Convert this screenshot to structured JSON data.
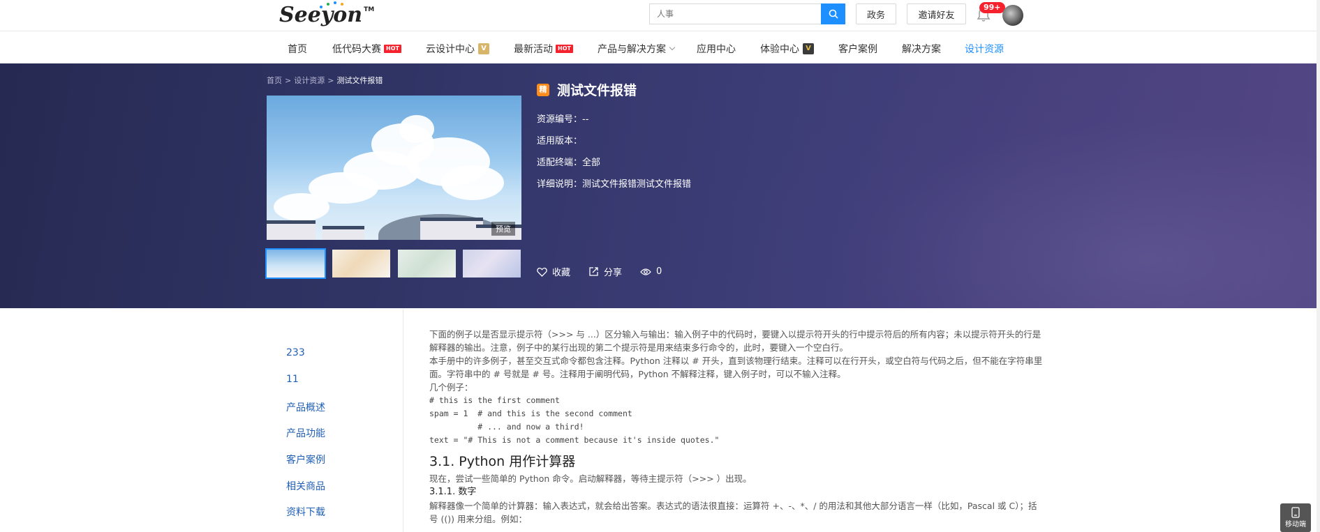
{
  "header": {
    "logo_text": "Seeyon",
    "logo_tm": "TM",
    "search_placeholder": "人事",
    "gov_button": "政务",
    "invite_button": "邀请好友",
    "notification_badge": "99+"
  },
  "nav": {
    "items": [
      {
        "label": "首页"
      },
      {
        "label": "低代码大赛",
        "tag": "HOT"
      },
      {
        "label": "云设计中心",
        "vtag": "V"
      },
      {
        "label": "最新活动",
        "tag": "HOT"
      },
      {
        "label": "产品与解决方案"
      },
      {
        "label": "应用中心"
      },
      {
        "label": "体验中心",
        "vtag": "V"
      },
      {
        "label": "客户案例"
      },
      {
        "label": "解决方案"
      },
      {
        "label": "设计资源",
        "active": true
      }
    ]
  },
  "breadcrumb": {
    "home": "首页",
    "sep": ">",
    "parent": "设计资源",
    "current": "测试文件报错"
  },
  "resource": {
    "badge": "精",
    "title": "测试文件报错",
    "preview_label": "预览",
    "fields": [
      {
        "label": "资源编号：",
        "value": "--"
      },
      {
        "label": "适用版本：",
        "value": ""
      },
      {
        "label": "适配终端：",
        "value": "全部"
      },
      {
        "label": "详细说明：",
        "value": "测试文件报错测试文件报错"
      }
    ],
    "favorite_label": "收藏",
    "share_label": "分享",
    "view_count": "0"
  },
  "sidebar": {
    "items": [
      "233",
      "11",
      "产品概述",
      "产品功能",
      "客户案例",
      "相关商品",
      "资料下载"
    ]
  },
  "content": {
    "para1": "下面的例子以是否显示提示符（>>> 与 ...）区分输入与输出：输入例子中的代码时，要键入以提示符开头的行中提示符后的所有内容；未以提示符开头的行是解释器的输出。注意，例子中的某行出现的第二个提示符是用来结束多行命令的，此时，要键入一个空白行。",
    "para2": "本手册中的许多例子，甚至交互式命令都包含注释。Python 注释以 # 开头，直到该物理行结束。注释可以在行开头，或空白符与代码之后，但不能在字符串里面。字符串中的 # 号就是 # 号。注释用于阐明代码，Python 不解释注释，键入例子时，可以不输入注释。",
    "para3": "几个例子：",
    "code1": "# this is the first comment",
    "code2": "spam = 1  # and this is the second comment",
    "code3": "          # ... and now a third!",
    "code4": "text = \"# This is not a comment because it's inside quotes.\"",
    "h2": "3.1. Python 用作计算器",
    "para4": "现在，尝试一些简单的 Python 命令。启动解释器，等待主提示符（>>> ）出现。",
    "h3": "3.1.1. 数字",
    "para5": "解释器像一个简单的计算器：输入表达式，就会给出答案。表达式的语法很直接：运算符 +、-、*、/ 的用法和其他大部分语言一样（比如，Pascal 或 C）；括号 (()) 用来分组。例如："
  },
  "mobile_label": "移动端",
  "colors": {
    "accent": "#1e8fff",
    "hot": "#f5222d",
    "badge_orange": "#ff8b1a",
    "banner": "#323668"
  }
}
